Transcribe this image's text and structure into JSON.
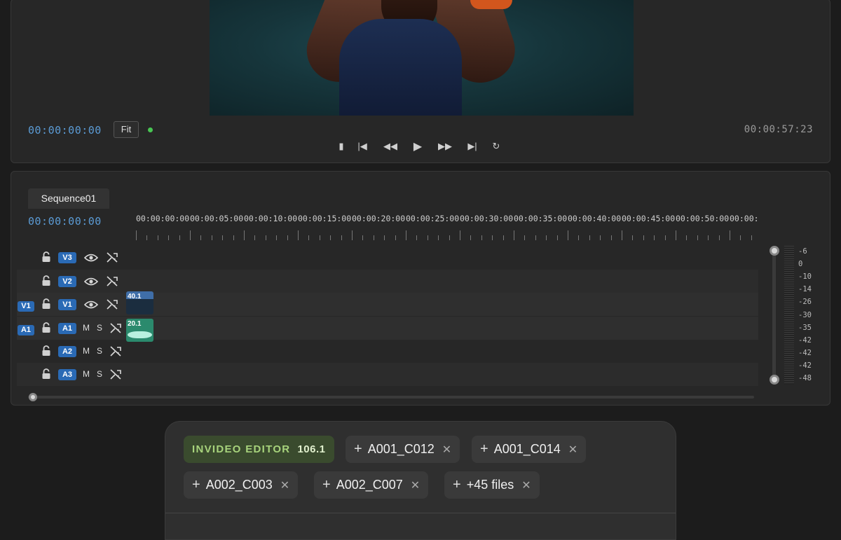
{
  "monitor": {
    "current_timecode": "00:00:00:00",
    "fit_label": "Fit",
    "duration_timecode": "00:00:57:23",
    "transport": [
      {
        "name": "mark-in-icon",
        "glyph": "▮"
      },
      {
        "name": "go-to-start-icon",
        "glyph": "|◀"
      },
      {
        "name": "rewind-icon",
        "glyph": "◀◀"
      },
      {
        "name": "play-icon",
        "glyph": "▶"
      },
      {
        "name": "fast-forward-icon",
        "glyph": "▶▶"
      },
      {
        "name": "go-to-end-icon",
        "glyph": "▶|"
      },
      {
        "name": "loop-icon",
        "glyph": "↻"
      }
    ]
  },
  "timeline": {
    "sequence_name": "Sequence01",
    "timecode": "00:00:00:00",
    "ruler_labels": [
      "00:00:00:00",
      "00:00:05:00",
      "00:00:10:00",
      "00:00:15:00",
      "00:00:20:00",
      "00:00:25:00",
      "00:00:30:00",
      "00:00:35:00",
      "00:00:40:00",
      "00:00:45:00",
      "00:00:50:00",
      "00:00:"
    ],
    "tracks": [
      {
        "id": "V3",
        "source": "",
        "kind": "video"
      },
      {
        "id": "V2",
        "source": "",
        "kind": "video"
      },
      {
        "id": "V1",
        "source": "V1",
        "kind": "video"
      },
      {
        "id": "A1",
        "source": "A1",
        "kind": "audio"
      },
      {
        "id": "A2",
        "source": "",
        "kind": "audio"
      },
      {
        "id": "A3",
        "source": "",
        "kind": "audio"
      }
    ],
    "mute_label": "M",
    "solo_label": "S",
    "clips": {
      "video_label": "40.1",
      "audio_label": "20.1"
    },
    "meter_labels": [
      "-6",
      "0",
      "-10",
      "-14",
      "-26",
      "-30",
      "-35",
      "-42",
      "-42",
      "-42",
      "-48"
    ]
  },
  "chips": {
    "brand": "INVIDEO EDITOR",
    "version": "106.1",
    "files": [
      "A001_C012",
      "A001_C014",
      "A002_C003",
      "A002_C007",
      "+45 files"
    ]
  },
  "colors": {
    "accent_blue": "#2a6ab5",
    "timecode_blue": "#5b9bd5",
    "brand_green": "#a7d37c",
    "status_green": "#48c553"
  }
}
